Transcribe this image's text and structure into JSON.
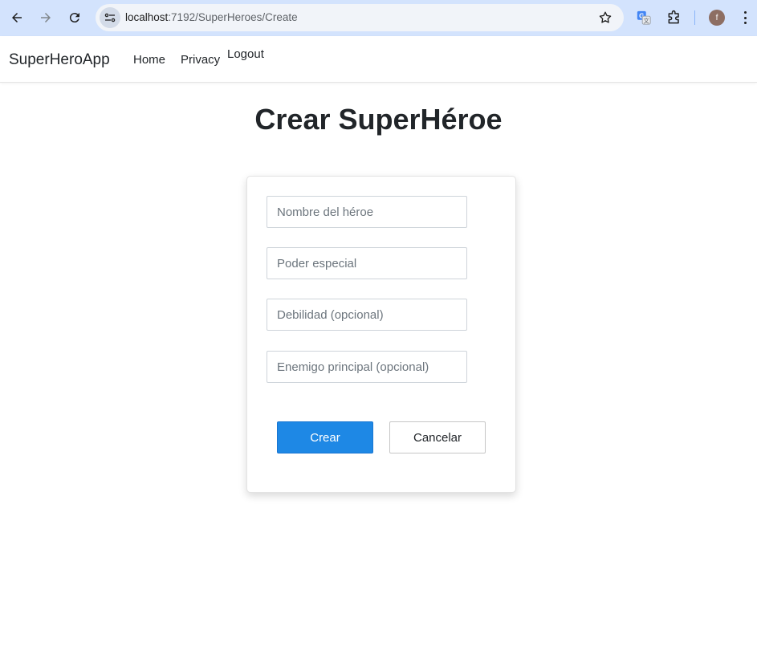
{
  "browser": {
    "url_host": "localhost",
    "url_path": ":7192/SuperHeroes/Create",
    "avatar_letter": "f"
  },
  "navbar": {
    "brand": "SuperHeroApp",
    "links": [
      "Home",
      "Privacy",
      "Logout"
    ]
  },
  "page": {
    "title": "Crear SuperHéroe"
  },
  "form": {
    "fields": [
      {
        "placeholder": "Nombre del héroe",
        "value": ""
      },
      {
        "placeholder": "Poder especial",
        "value": ""
      },
      {
        "placeholder": "Debilidad (opcional)",
        "value": ""
      },
      {
        "placeholder": "Enemigo principal (opcional)",
        "value": ""
      }
    ],
    "submit_label": "Crear",
    "cancel_label": "Cancelar"
  },
  "colors": {
    "chrome_bar": "#d3e3fd",
    "primary_button": "#1e88e5",
    "avatar": "#8d6e63"
  }
}
